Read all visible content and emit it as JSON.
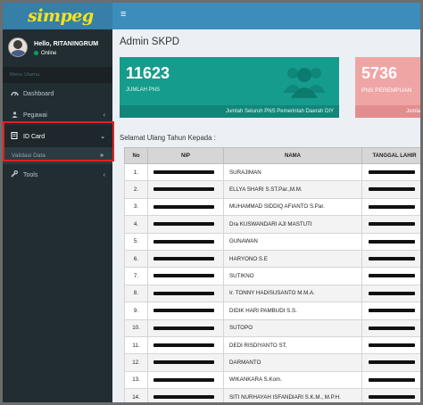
{
  "app": {
    "logo_text": "simpeg"
  },
  "user": {
    "greeting": "Hello, RITANINGRUM",
    "status": "Online"
  },
  "sidebar": {
    "section_header": "Menu Utama",
    "items": [
      {
        "label": "Dashboard",
        "icon": "dashboard-icon"
      },
      {
        "label": "Pegawai",
        "icon": "users-icon",
        "chevron": "‹"
      },
      {
        "label": "ID Card",
        "icon": "id-card-icon",
        "chevron": "⌄",
        "active": true
      },
      {
        "label": "Tools",
        "icon": "wrench-icon",
        "chevron": "‹"
      }
    ],
    "submenu": {
      "label": "Validasi Data",
      "chevron": "»"
    }
  },
  "topbar": {
    "toggle_icon": "≡"
  },
  "page": {
    "title": "Admin SKPD"
  },
  "stats": [
    {
      "value": "11623",
      "label": "JUMLAH PNS",
      "footer": "Jumlah Seluruh PNS Pemerintah Daerah DIY",
      "color": "#169c8c"
    },
    {
      "value": "5736",
      "label": "PNS PEREMPUAN",
      "footer": "Jumlah",
      "color": "#f0a5a5"
    }
  ],
  "greeting": "Selamat Ulang Tahun Kepada :",
  "table": {
    "headers": [
      "No",
      "NIP",
      "NAMA",
      "TANGGAL LAHIR"
    ],
    "rows": [
      {
        "no": "1.",
        "nama": "SURAJIMAN"
      },
      {
        "no": "2.",
        "nama": "ELLYA SHARI S.ST.Par.,M.M."
      },
      {
        "no": "3.",
        "nama": "MUHAMMAD SIDDIQ AFIANTO S.Par."
      },
      {
        "no": "4.",
        "nama": "Dra KUSWANDARI AJI MASTUTI"
      },
      {
        "no": "5.",
        "nama": "GUNAWAN"
      },
      {
        "no": "6.",
        "nama": "HARYONO S.E"
      },
      {
        "no": "7.",
        "nama": "SUTIKNO"
      },
      {
        "no": "8.",
        "nama": "Ir. TONNY HADISUSANTO M.M.A."
      },
      {
        "no": "9.",
        "nama": "DIDIK HARI PAMBUDI S.S."
      },
      {
        "no": "10.",
        "nama": "SUTOPO"
      },
      {
        "no": "11.",
        "nama": "DEDI RISDIYANTO ST."
      },
      {
        "no": "12.",
        "nama": "DARMANTO"
      },
      {
        "no": "13.",
        "nama": "WIKANKARA S.Kom."
      },
      {
        "no": "14.",
        "nama": "SITI NURHAYAH ISFANDIARI S.K.M., M.P.H."
      }
    ]
  }
}
